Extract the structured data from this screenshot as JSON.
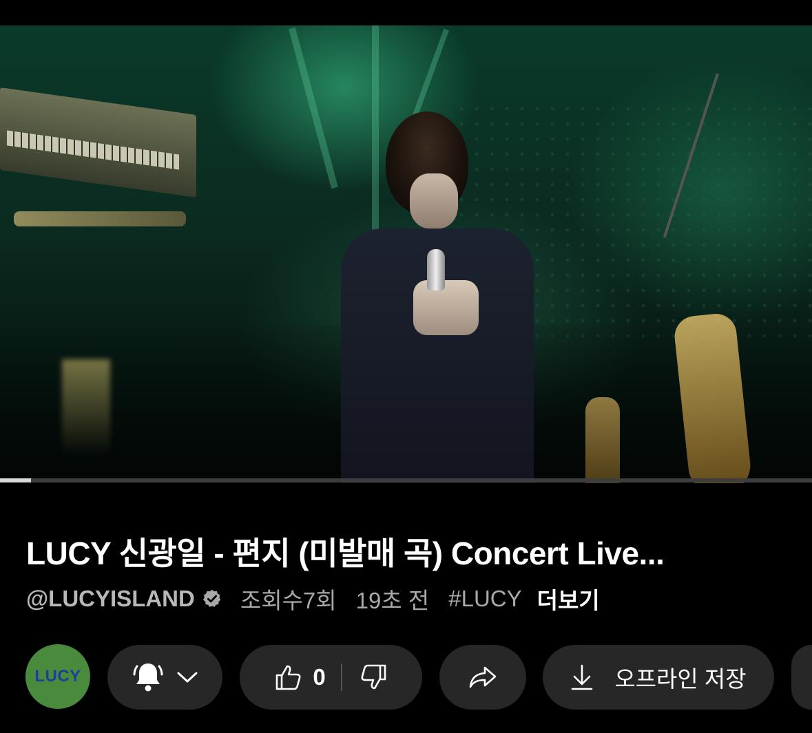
{
  "video": {
    "progress_fraction": 0.038
  },
  "title": "LUCY 신광일 - 편지 (미발매 곡) Concert Live...",
  "meta": {
    "channel_handle": "@LUCYISLAND",
    "views": "조회수7회",
    "age": "19초 전",
    "hashtag": "#LUCY",
    "more_label": "더보기"
  },
  "actions": {
    "avatar_text": "LUCY",
    "like_count": "0",
    "download_label": "오프라인 저장"
  },
  "colors": {
    "background": "#000000",
    "pill": "#272727",
    "avatar_bg": "#4a8a3c",
    "avatar_text": "#1d3f9a",
    "meta_text": "#a9a9a9"
  },
  "icons": [
    "verified-icon",
    "bell-icon",
    "chevron-down-icon",
    "thumbs-up-icon",
    "thumbs-down-icon",
    "share-icon",
    "download-icon"
  ]
}
